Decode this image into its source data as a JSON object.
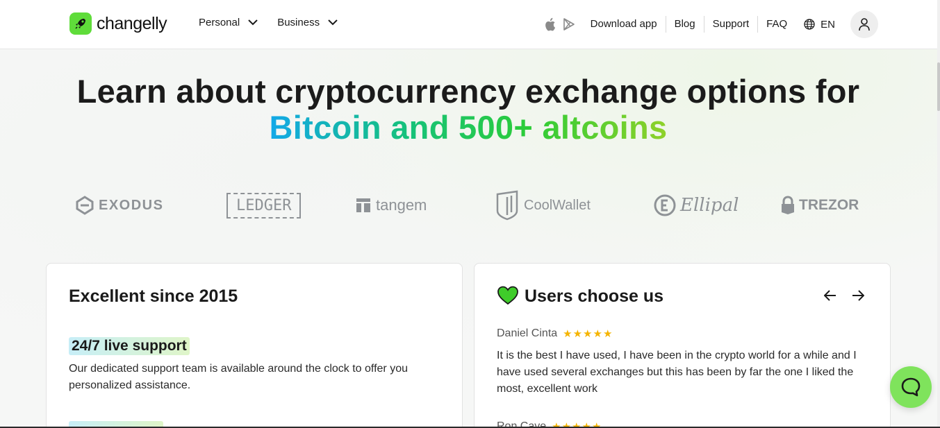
{
  "header": {
    "brand": "changelly",
    "nav_left": [
      {
        "label": "Personal"
      },
      {
        "label": "Business"
      }
    ],
    "download_label": "Download app",
    "links": [
      {
        "label": "Blog"
      },
      {
        "label": "Support"
      },
      {
        "label": "FAQ"
      }
    ],
    "language": "EN",
    "icons": {
      "apple": "apple-icon",
      "play": "google-play-icon",
      "globe": "globe-icon",
      "user": "user-icon"
    }
  },
  "hero": {
    "title_line1": "Learn about cryptocurrency exchange options for",
    "title_line2": "Bitcoin and 500+ altcoins"
  },
  "wallets": [
    {
      "name": "EXODUS"
    },
    {
      "name": "LEDGER"
    },
    {
      "name": "tangem"
    },
    {
      "name": "CoolWallet"
    },
    {
      "name": "Ellipal"
    },
    {
      "name": "TREZOR"
    }
  ],
  "card_left": {
    "title": "Excellent since 2015",
    "feature_title": "24/7 live support",
    "feature_desc": "Our dedicated support team is available around the clock to offer you personalized assistance."
  },
  "card_right": {
    "title": "Users choose us",
    "reviews": [
      {
        "author": "Daniel Cinta",
        "rating": 5,
        "stars": "★★★★★",
        "text": "It is the best I have used, I have been in the crypto world for a while and I have used several exchanges but this has been by far the one I liked the most, excellent work"
      },
      {
        "author": "Ron Cave",
        "rating": 5,
        "stars": "★★★★★"
      }
    ]
  },
  "colors": {
    "brand_green": "#5fdc3a",
    "gradient_start": "#13a8e8",
    "gradient_end": "#8fd12a",
    "star": "#f5b400"
  }
}
